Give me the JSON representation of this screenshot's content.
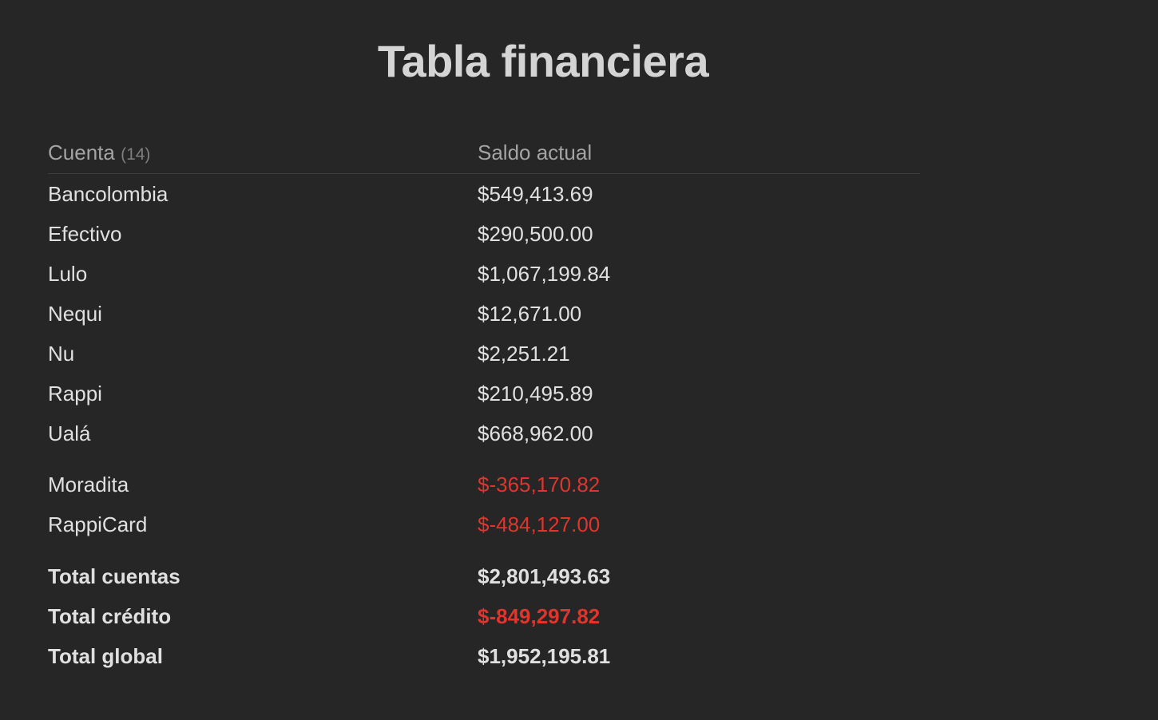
{
  "title": "Tabla financiera",
  "table": {
    "header": {
      "account_label": "Cuenta",
      "account_count": "(14)",
      "balance_label": "Saldo actual"
    },
    "accounts": [
      {
        "name": "Bancolombia",
        "balance": "$549,413.69"
      },
      {
        "name": "Efectivo",
        "balance": "$290,500.00"
      },
      {
        "name": "Lulo",
        "balance": "$1,067,199.84"
      },
      {
        "name": "Nequi",
        "balance": "$12,671.00"
      },
      {
        "name": "Nu",
        "balance": "$2,251.21"
      },
      {
        "name": "Rappi",
        "balance": "$210,495.89"
      },
      {
        "name": "Ualá",
        "balance": "$668,962.00"
      }
    ],
    "credit": [
      {
        "name": "Moradita",
        "balance": "$-365,170.82"
      },
      {
        "name": "RappiCard",
        "balance": "$-484,127.00"
      }
    ],
    "totals": [
      {
        "name": "Total cuentas",
        "balance": "$2,801,493.63",
        "negative": false
      },
      {
        "name": "Total crédito",
        "balance": "$-849,297.82",
        "negative": true
      },
      {
        "name": "Total global",
        "balance": "$1,952,195.81",
        "negative": false
      }
    ]
  },
  "colors": {
    "background": "#262626",
    "text": "#e0e0e0",
    "muted": "#a4a4a4",
    "negative": "#e0342c"
  }
}
